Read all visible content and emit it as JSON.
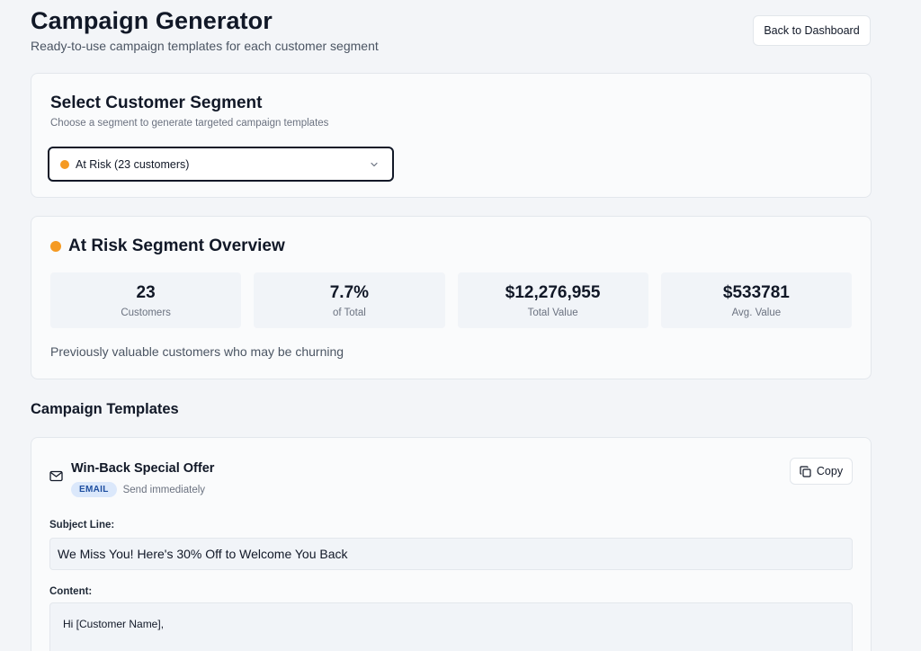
{
  "header": {
    "title": "Campaign Generator",
    "subtitle": "Ready-to-use campaign templates for each customer segment",
    "back_label": "Back to Dashboard"
  },
  "segment_select": {
    "title": "Select Customer Segment",
    "description": "Choose a segment to generate targeted campaign templates",
    "selected_value": "At Risk (23 customers)",
    "dot_color": "#f59a23"
  },
  "overview": {
    "title": "At Risk Segment Overview",
    "dot_color": "#f59a23",
    "stats": [
      {
        "value": "23",
        "label": "Customers"
      },
      {
        "value": "7.7%",
        "label": "of Total"
      },
      {
        "value": "$12,276,955",
        "label": "Total Value"
      },
      {
        "value": "$533781",
        "label": "Avg. Value"
      }
    ],
    "description": "Previously valuable customers who may be churning"
  },
  "templates_section": {
    "title": "Campaign Templates",
    "items": [
      {
        "icon": "mail-icon",
        "title": "Win-Back Special Offer",
        "channel": "EMAIL",
        "timing": "Send immediately",
        "copy_label": "Copy",
        "subject_label": "Subject Line:",
        "subject": "We Miss You! Here's 30% Off to Welcome You Back",
        "content_label": "Content:",
        "content_first_line": "Hi [Customer Name],"
      }
    ]
  }
}
